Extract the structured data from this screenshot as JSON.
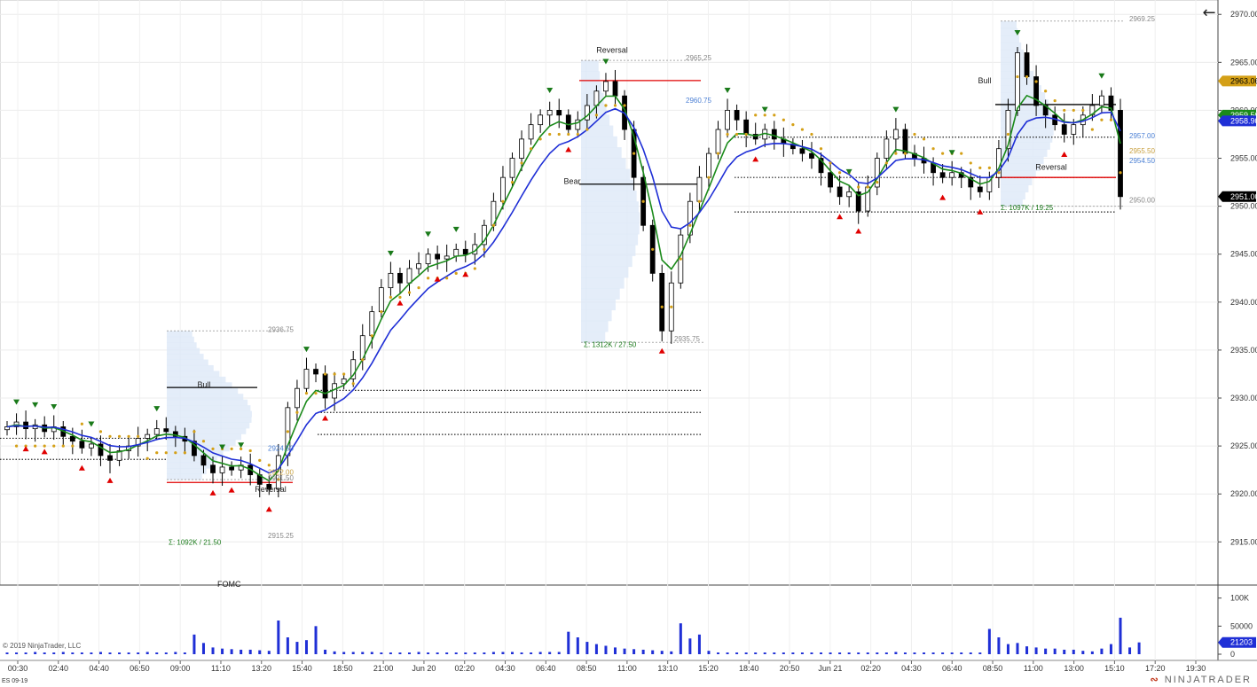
{
  "chart_title": "",
  "instrument": "ES 09-19",
  "brand": "NINJATRADER",
  "copyright": "© 2019 NinjaTrader, LLC",
  "back_icon": "arrow-left-icon",
  "colors": {
    "up_candle": "#ffffff",
    "down_candle": "#000000",
    "ema_fast": "#1a8a1a",
    "ema_slow": "#1f2fd6",
    "psar": "#d4a017",
    "swing_high": "#1a7a1a",
    "swing_low": "#e00000",
    "volume": "#1f2fd6",
    "profile": "#dde8f7",
    "value_area_line": "#e8c87a"
  },
  "chart_data": {
    "type": "candlestick",
    "y_axis": {
      "ticks": [
        "2915.00",
        "2920.00",
        "2925.00",
        "2930.00",
        "2935.00",
        "2940.00",
        "2945.00",
        "2950.00",
        "2955.00",
        "2960.00",
        "2965.00",
        "2970.00"
      ],
      "range": [
        2910.5,
        2971.5
      ]
    },
    "x_axis": {
      "ticks": [
        "00:30",
        "02:40",
        "04:40",
        "06:50",
        "09:00",
        "11:10",
        "13:20",
        "15:40",
        "18:50",
        "21:00",
        "Jun 20",
        "02:20",
        "04:30",
        "06:40",
        "08:50",
        "11:00",
        "13:10",
        "15:20",
        "18:40",
        "20:50",
        "Jun 21",
        "02:20",
        "04:30",
        "06:40",
        "08:50",
        "11:00",
        "13:00",
        "15:10",
        "17:20",
        "19:30"
      ]
    },
    "price_badges": [
      {
        "value": "2963.06",
        "bg": "#d4a017",
        "fg": "#000"
      },
      {
        "value": "2959.50",
        "bg": "#1a8a1a",
        "fg": "#fff"
      },
      {
        "value": "2958.90",
        "bg": "#1f2fd6",
        "fg": "#fff"
      },
      {
        "value": "2951.00",
        "bg": "#000000",
        "fg": "#fff"
      }
    ],
    "volume_axis": {
      "ticks": [
        "100K",
        "50000",
        "0"
      ],
      "current": "21203"
    },
    "annotations": [
      {
        "text": "Bull",
        "x_index": 230,
        "price": 2931.1
      },
      {
        "text": "Reversal",
        "x_index": 305,
        "price": 2920.2
      },
      {
        "text": "Reversal",
        "x_index": 690,
        "price": 2966.0
      },
      {
        "text": "Bear",
        "x_index": 645,
        "price": 2952.3
      },
      {
        "text": "Bull",
        "x_index": 1110,
        "price": 2962.8
      },
      {
        "text": "Reversal",
        "x_index": 1185,
        "price": 2953.8
      }
    ],
    "profile_labels": [
      {
        "text": "2936.75",
        "price": 2936.9,
        "color": "#888"
      },
      {
        "text": "2924.50",
        "price": 2924.5,
        "color": "#4a7fd4"
      },
      {
        "text": "2922.00",
        "price": 2922.0,
        "color": "#c8a040"
      },
      {
        "text": "2921.50",
        "price": 2921.4,
        "color": "#888"
      },
      {
        "text": "2915.25",
        "price": 2915.4,
        "color": "#888"
      },
      {
        "text": "Σ: 1092K / 21.50",
        "price": 2914.7,
        "color": "#1a7a1a"
      },
      {
        "text": "2965.25",
        "price": 2965.2,
        "color": "#888"
      },
      {
        "text": "2960.75",
        "price": 2960.8,
        "color": "#4a7fd4"
      },
      {
        "text": "2935.75",
        "price": 2935.9,
        "color": "#888"
      },
      {
        "text": "Σ: 1312K / 27.50",
        "price": 2935.3,
        "color": "#1a7a1a"
      },
      {
        "text": "2969.25",
        "price": 2969.3,
        "color": "#888"
      },
      {
        "text": "2957.00",
        "price": 2957.1,
        "color": "#4a7fd4"
      },
      {
        "text": "2955.50",
        "price": 2955.5,
        "color": "#c8a040"
      },
      {
        "text": "2954.50",
        "price": 2954.5,
        "color": "#4a7fd4"
      },
      {
        "text": "2950.00",
        "price": 2950.4,
        "color": "#888"
      },
      {
        "text": "Σ: 1097K / 19.25",
        "price": 2949.6,
        "color": "#1a7a1a"
      }
    ],
    "partial_label": "FOMC",
    "close": [
      2927.0,
      2927.5,
      2926.8,
      2927.2,
      2926.5,
      2927.0,
      2926.0,
      2925.5,
      2924.8,
      2925.2,
      2924.0,
      2923.5,
      2924.5,
      2925.0,
      2925.8,
      2926.2,
      2926.8,
      2926.5,
      2926.0,
      2925.5,
      2924.0,
      2923.0,
      2922.2,
      2922.8,
      2922.5,
      2923.0,
      2922.0,
      2921.0,
      2920.5,
      2924.0,
      2929.0,
      2931.0,
      2933.0,
      2932.5,
      2930.0,
      2931.5,
      2932.0,
      2934.0,
      2936.5,
      2939.0,
      2941.5,
      2943.0,
      2942.0,
      2943.5,
      2944.0,
      2945.0,
      2944.5,
      2944.8,
      2945.5,
      2945.0,
      2946.0,
      2948.0,
      2950.5,
      2953.0,
      2955.0,
      2957.0,
      2958.5,
      2959.5,
      2960.0,
      2959.5,
      2958.0,
      2959.0,
      2960.5,
      2962.0,
      2963.0,
      2961.5,
      2958.0,
      2953.0,
      2948.0,
      2943.0,
      2937.0,
      2942.0,
      2947.0,
      2950.5,
      2953.0,
      2955.5,
      2958.0,
      2960.0,
      2959.0,
      2957.5,
      2957.0,
      2958.0,
      2957.0,
      2956.5,
      2956.0,
      2955.5,
      2955.0,
      2953.5,
      2952.0,
      2951.0,
      2951.5,
      2949.5,
      2952.0,
      2955.0,
      2957.0,
      2958.0,
      2955.5,
      2955.0,
      2954.5,
      2953.5,
      2953.0,
      2953.5,
      2953.0,
      2952.0,
      2951.5,
      2953.0,
      2956.0,
      2960.0,
      2966.0,
      2963.5,
      2960.5,
      2959.5,
      2958.5,
      2957.5,
      2958.5,
      2959.5,
      2960.5,
      2961.5,
      2960.0,
      2951.0
    ],
    "volume": [
      3,
      3,
      3,
      4,
      3,
      3,
      4,
      3,
      3,
      3,
      4,
      3,
      3,
      3,
      3,
      4,
      3,
      3,
      4,
      3,
      35,
      20,
      12,
      10,
      9,
      8,
      8,
      7,
      6,
      60,
      30,
      22,
      25,
      50,
      8,
      5,
      4,
      4,
      4,
      4,
      3,
      3,
      3,
      3,
      4,
      3,
      3,
      3,
      3,
      3,
      3,
      3,
      4,
      4,
      4,
      3,
      3,
      4,
      4,
      4,
      40,
      30,
      22,
      18,
      15,
      12,
      10,
      9,
      8,
      7,
      6,
      5,
      55,
      28,
      35,
      6,
      3,
      3,
      3,
      3,
      3,
      3,
      3,
      3,
      3,
      3,
      3,
      3,
      3,
      3,
      3,
      3,
      3,
      3,
      3,
      4,
      3,
      3,
      3,
      3,
      3,
      3,
      3,
      3,
      3,
      45,
      30,
      18,
      20,
      14,
      12,
      10,
      10,
      8,
      8,
      6,
      5,
      10,
      18,
      65,
      12,
      21
    ]
  }
}
